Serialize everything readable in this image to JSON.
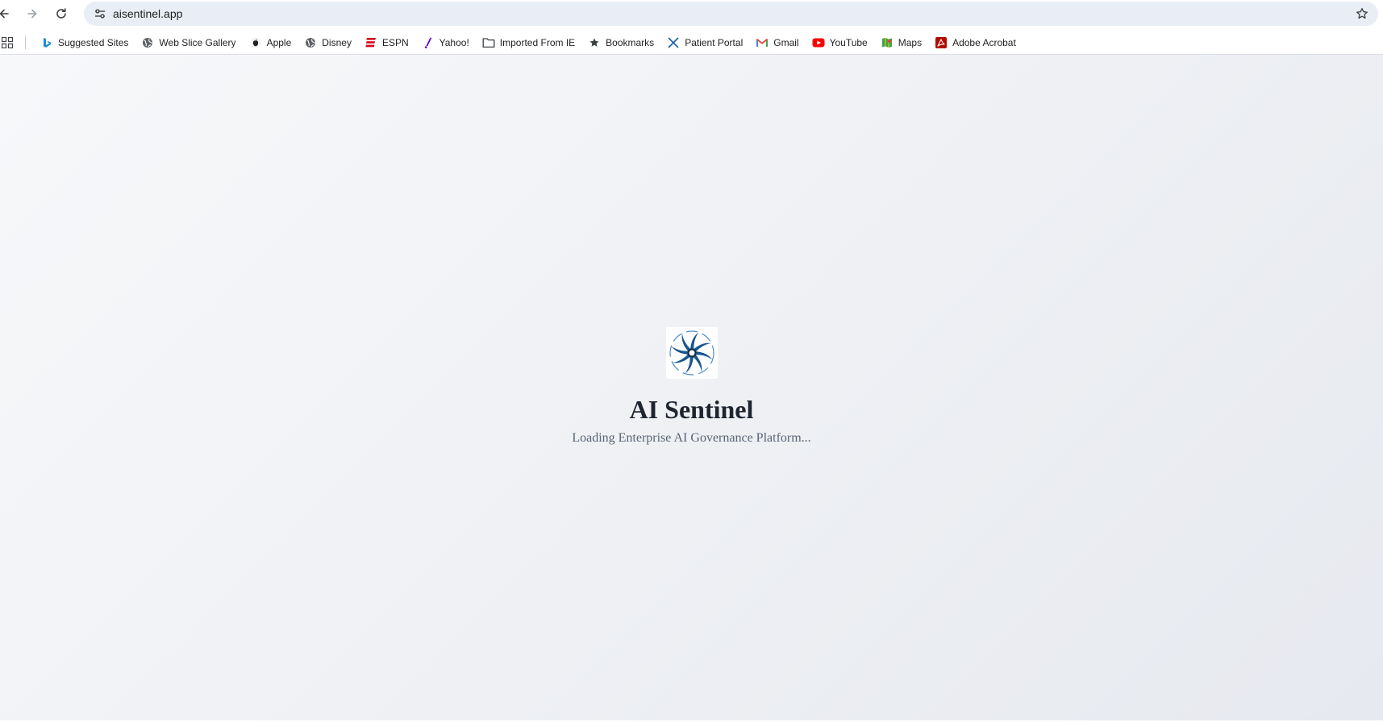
{
  "browser": {
    "url": "aisentinel.app",
    "bookmarks": [
      {
        "label": "Suggested Sites",
        "icon": "bing-icon"
      },
      {
        "label": "Web Slice Gallery",
        "icon": "globe-icon"
      },
      {
        "label": "Apple",
        "icon": "apple-icon"
      },
      {
        "label": "Disney",
        "icon": "globe-icon"
      },
      {
        "label": "ESPN",
        "icon": "espn-icon"
      },
      {
        "label": "Yahoo!",
        "icon": "yahoo-icon"
      },
      {
        "label": "Imported From IE",
        "icon": "folder-icon"
      },
      {
        "label": "Bookmarks",
        "icon": "star-icon"
      },
      {
        "label": "Patient Portal",
        "icon": "x-icon"
      },
      {
        "label": "Gmail",
        "icon": "gmail-icon"
      },
      {
        "label": "YouTube",
        "icon": "youtube-icon"
      },
      {
        "label": "Maps",
        "icon": "maps-icon"
      },
      {
        "label": "Adobe Acrobat",
        "icon": "acrobat-icon"
      }
    ]
  },
  "page": {
    "title": "AI Sentinel",
    "loading_text": "Loading Enterprise AI Governance Platform..."
  },
  "colors": {
    "omnibox_bg": "#e9eef6",
    "title": "#1e2430",
    "subtitle": "#5a6475",
    "logo_blue": "#1e6fb8",
    "logo_dark": "#0f2a44"
  }
}
